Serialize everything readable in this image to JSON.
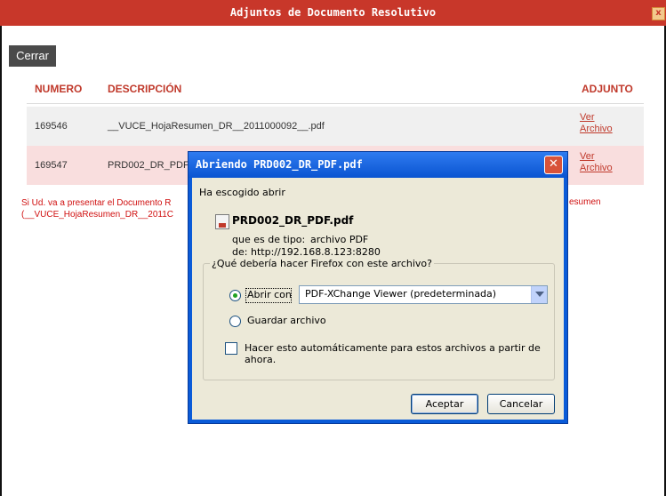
{
  "outer": {
    "title": "Adjuntos de Documento Resolutivo",
    "close_glyph": "x",
    "close_button": "Cerrar",
    "table": {
      "headers": [
        "NUMERO",
        "DESCRIPCIÓN",
        "ADJUNTO"
      ],
      "rows": [
        {
          "numero": "169546",
          "descripcion": "__VUCE_HojaResumen_DR__2011000092__.pdf",
          "link1": "Ver",
          "link2": "Archivo"
        },
        {
          "numero": "169547",
          "descripcion": "PRD002_DR_PDF.",
          "link1": "Ver",
          "link2": "Archivo"
        }
      ]
    },
    "notice_line1": "Si Ud. va a presentar el Documento R",
    "notice_line2": "(__VUCE_HojaResumen_DR__2011C",
    "notice_right": "esumen"
  },
  "dialog": {
    "title": "Abriendo PRD002_DR_PDF.pdf",
    "chosen_label": "Ha escogido abrir",
    "file_name": "PRD002_DR_PDF.pdf",
    "type_label": "que es de tipo:",
    "type_value": "archivo PDF",
    "from_label": "de:",
    "from_value": "http://192.168.8.123:8280",
    "question": "¿Qué debería hacer Firefox con este archivo?",
    "open_with_label": "Abrir con",
    "open_with_app": "PDF-XChange Viewer (predeterminada)",
    "save_label": "Guardar archivo",
    "auto_label": "Hacer esto automáticamente para estos archivos a partir de ahora.",
    "ok_button": "Aceptar",
    "cancel_button": "Cancelar"
  }
}
